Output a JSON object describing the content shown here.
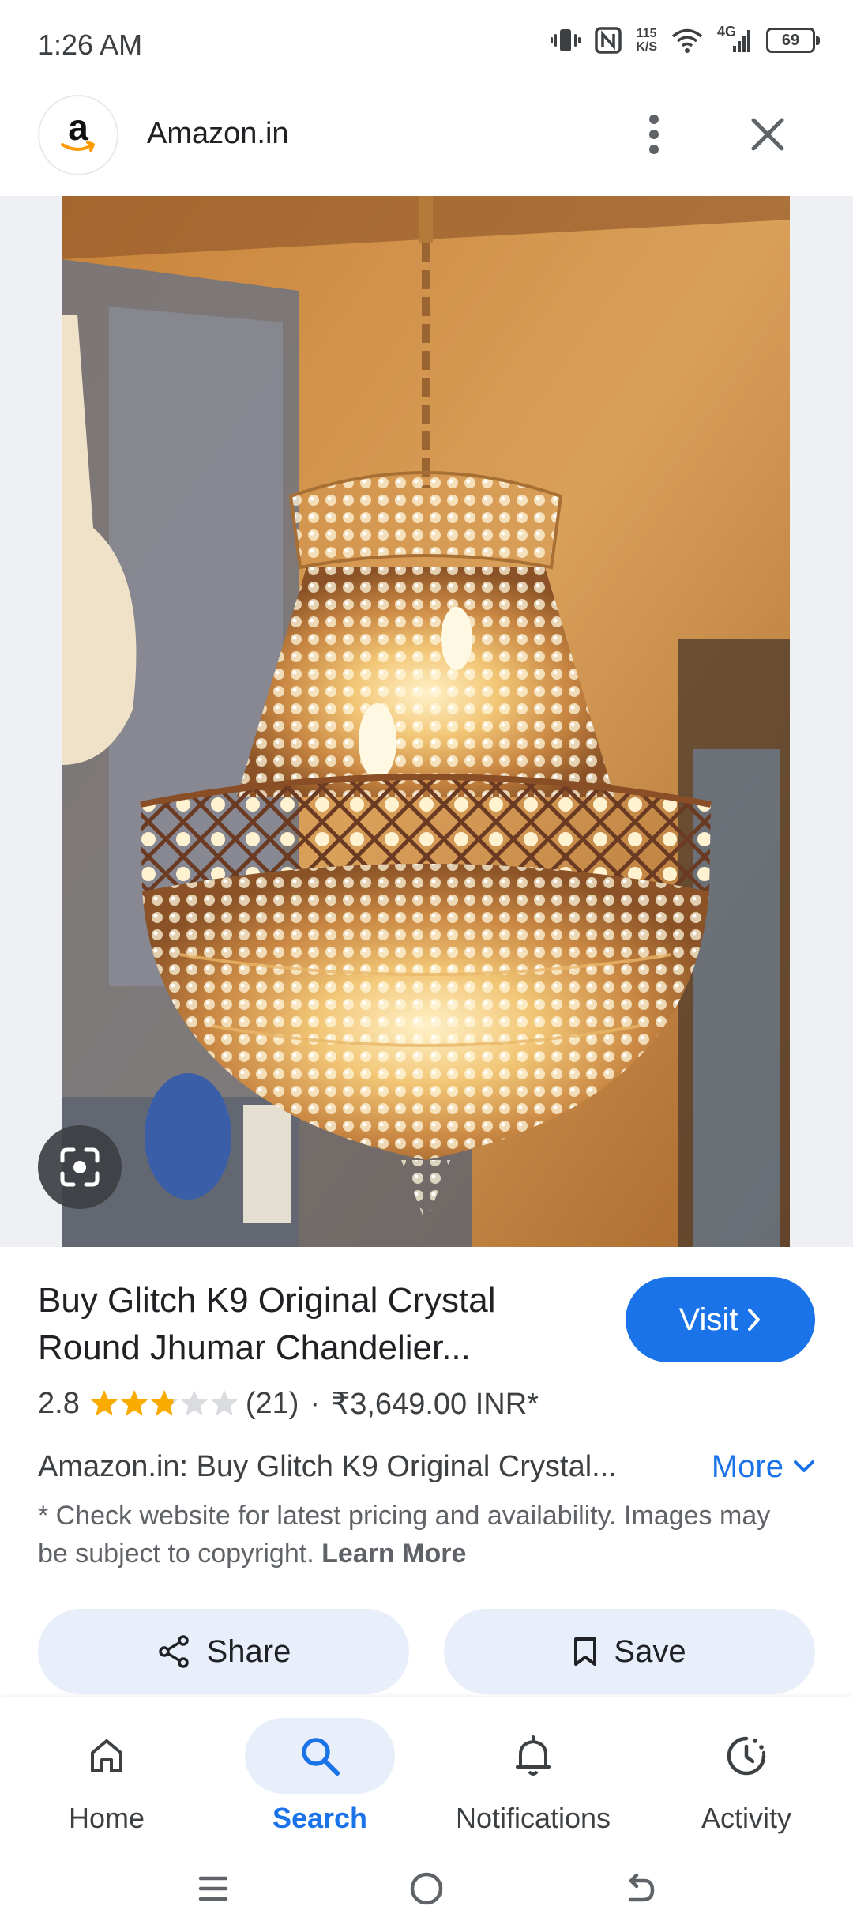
{
  "status_bar": {
    "time": "1:26 AM",
    "network_speed_value": "115",
    "network_speed_unit": "K/S",
    "network_type": "4G",
    "battery_level": "69"
  },
  "header": {
    "site_name": "Amazon.in",
    "logo_letter": "a"
  },
  "product": {
    "title_line_1": "Buy Glitch K9 Original Crystal",
    "title_line_2": "Round Jhumar Chandelier...",
    "visit_label": "Visit",
    "rating_value": "2.8",
    "rating_stars_filled": 2.8,
    "rating_stars_total": 5,
    "review_count": "(21)",
    "separator": "·",
    "price": "₹3,649.00 INR*",
    "description": "Amazon.in: Buy Glitch K9 Original Crystal...",
    "more_label": "More",
    "disclaimer": "* Check website for latest pricing and availability. Images may be subject to copyright.",
    "learn_more_label": "Learn More"
  },
  "actions": {
    "share_label": "Share",
    "save_label": "Save"
  },
  "bottom_nav": {
    "items": [
      {
        "label": "Home",
        "icon": "home-icon"
      },
      {
        "label": "Search",
        "icon": "search-icon",
        "active": true
      },
      {
        "label": "Notifications",
        "icon": "bell-icon"
      },
      {
        "label": "Activity",
        "icon": "activity-icon"
      }
    ]
  },
  "colors": {
    "accent": "#1a73e8",
    "chip_background": "#e8eefa",
    "star": "#f9ab00",
    "amazon_smile": "#ff9900"
  }
}
